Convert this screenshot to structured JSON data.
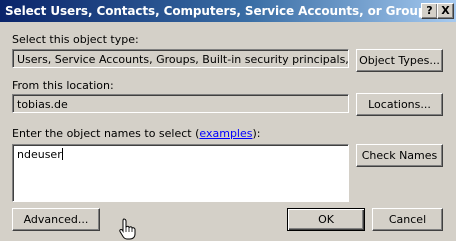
{
  "window": {
    "title": "Select Users, Contacts, Computers, Service Accounts, or Groups",
    "help_glyph": "?",
    "close_glyph": "X"
  },
  "object_type": {
    "label": "Select this object type:",
    "value": "Users, Service Accounts, Groups, Built-in security principals, or Other o",
    "button": "Object Types..."
  },
  "location": {
    "label": "From this location:",
    "value": "tobias.de",
    "button": "Locations..."
  },
  "names": {
    "label_prefix": "Enter the object names to select (",
    "label_link": "examples",
    "label_suffix": "):",
    "value": "ndeuser",
    "check_button": "Check Names"
  },
  "footer": {
    "advanced": "Advanced...",
    "ok": "OK",
    "cancel": "Cancel"
  }
}
